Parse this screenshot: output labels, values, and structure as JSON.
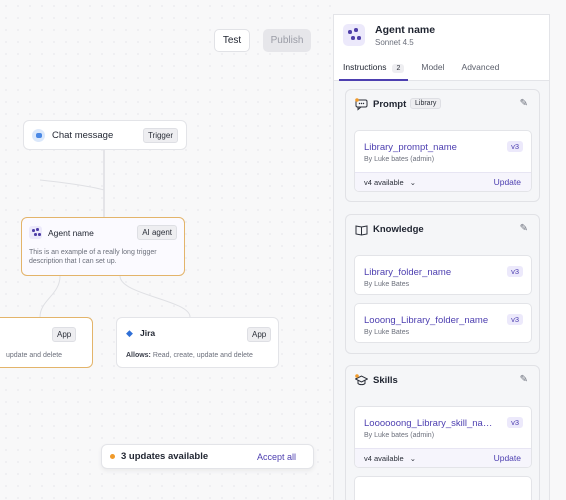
{
  "toolbar": {
    "test_label": "Test",
    "publish_label": "Publish"
  },
  "canvas": {
    "chat_node": {
      "label": "Chat message",
      "tag": "Trigger"
    },
    "agent_node": {
      "label": "Agent name",
      "tag": "AI agent",
      "description": "This is an example of a really long trigger description that I can set up."
    },
    "left_node": {
      "tag": "App",
      "text": "update and delete"
    },
    "jira_node": {
      "label": "Jira",
      "tag": "App",
      "allows_label": "Allows:",
      "allows_text": " Read, create, update and delete"
    },
    "updates_banner": {
      "text": "3 updates available",
      "action": "Accept all"
    }
  },
  "panel": {
    "agent_name": "Agent name",
    "model": "Sonnet 4.5",
    "tabs": [
      {
        "label": "Instructions",
        "count": "2"
      },
      {
        "label": "Model"
      },
      {
        "label": "Advanced"
      }
    ],
    "prompt": {
      "title": "Prompt",
      "tag": "Library",
      "item": {
        "name": "Library_prompt_name",
        "by": "By Luke bates (admin)",
        "version": "v3",
        "available": "v4 available",
        "update": "Update"
      }
    },
    "knowledge": {
      "title": "Knowledge",
      "items": [
        {
          "name": "Library_folder_name",
          "by": "By Luke Bates",
          "version": "v3"
        },
        {
          "name": "Looong_Library_folder_name",
          "by": "By Luke Bates",
          "version": "v3"
        }
      ]
    },
    "skills": {
      "title": "Skills",
      "item": {
        "name": "Loooooong_Library_skill_name",
        "by": "By Luke bates (admin)",
        "version": "v3",
        "available": "v4 available",
        "update": "Update"
      }
    }
  },
  "colors": {
    "accent": "#4d3fb0",
    "warning": "#f09a2a",
    "highlight_border": "#e3b46a"
  }
}
